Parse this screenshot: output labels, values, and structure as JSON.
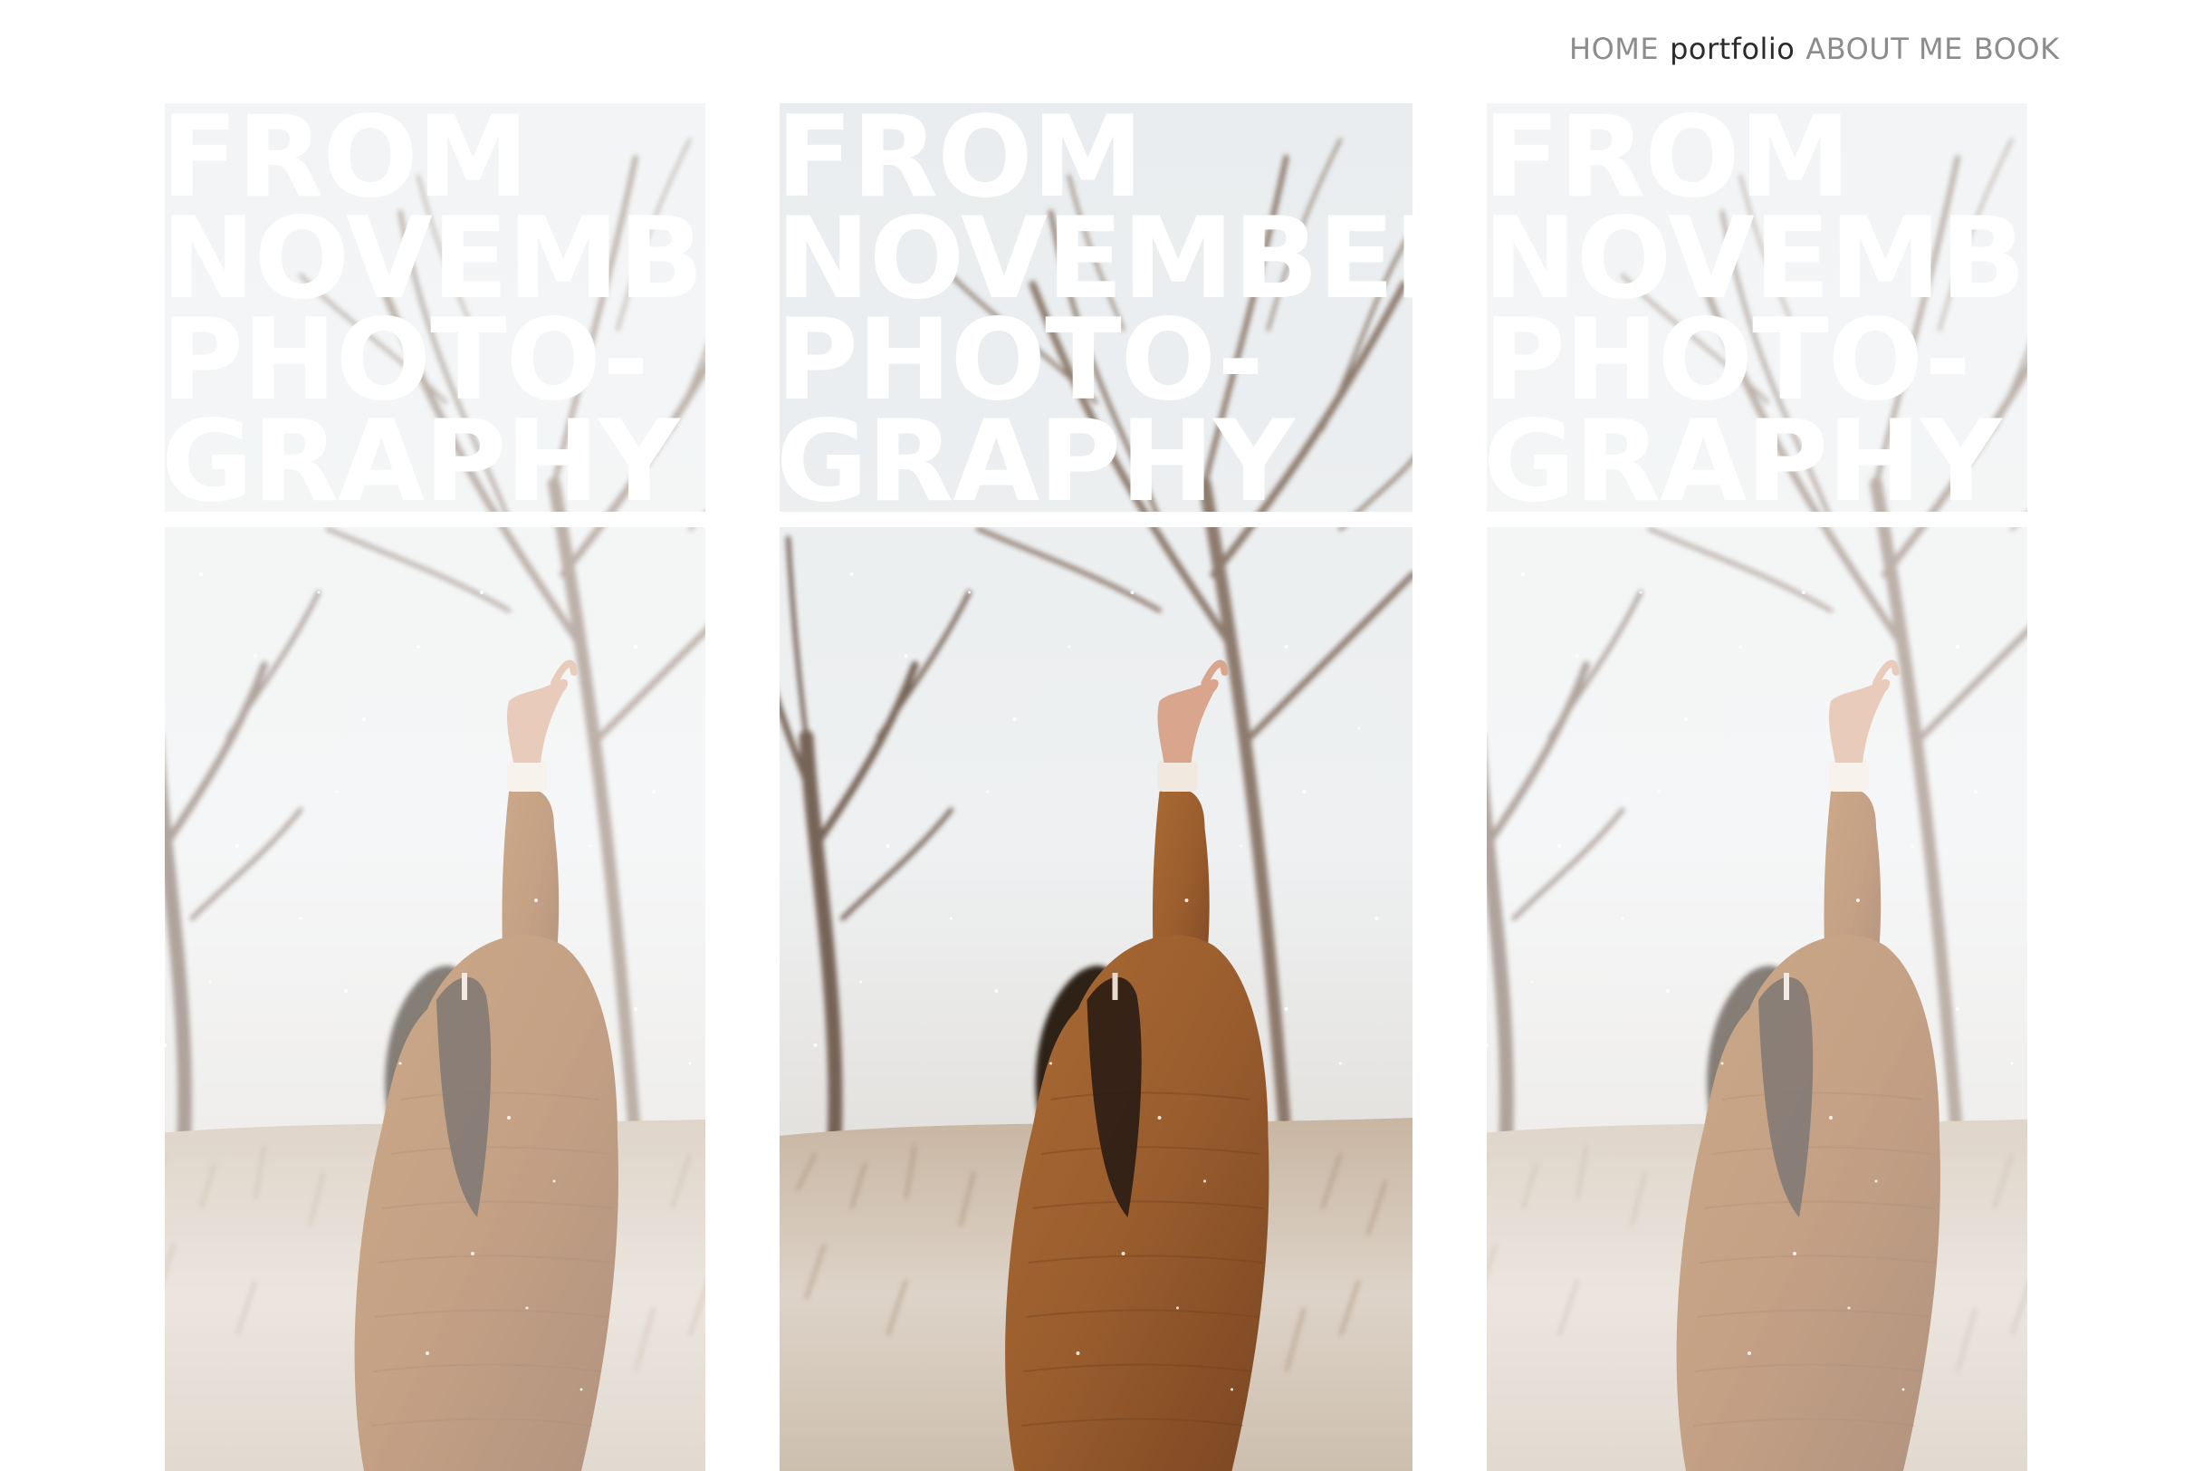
{
  "nav": {
    "items": [
      {
        "label": "HOME",
        "active": false
      },
      {
        "label": "portfolio",
        "active": true
      },
      {
        "label": "ABOUT ME",
        "active": false
      },
      {
        "label": "BOOK",
        "active": false
      }
    ]
  },
  "panels": [
    {
      "title_lines": [
        "FROM",
        "NOVEMBER",
        "PHOTO-",
        "GRAPHY"
      ],
      "style": "faded"
    },
    {
      "title_lines": [
        "FROM",
        "NOVEMBER",
        "PHOTO-",
        "GRAPHY"
      ],
      "style": "full-color"
    },
    {
      "title_lines": [
        "FROM",
        "NOVEMBER",
        "PHOTO-",
        "GRAPHY"
      ],
      "style": "faded"
    }
  ],
  "colors": {
    "nav_text": "#8c8c8c",
    "nav_active": "#2b2b2b",
    "sweater": "#9a5d2d",
    "trees": "#6b5446",
    "sky": "#eef0f1"
  },
  "icons": {
    "photo": "photograph of woman in brown sweater raising arm in snowy field"
  }
}
